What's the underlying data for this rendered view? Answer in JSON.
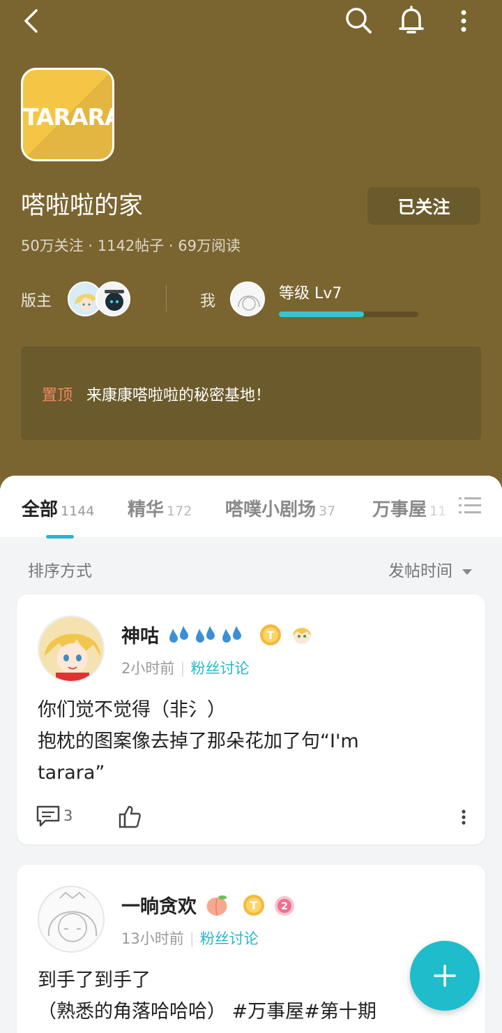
{
  "header": {
    "logo_text": "TARARA",
    "title": "嗒啦啦的家",
    "follow_label": "已关注",
    "stats": "50万关注 · 1142帖子 · 69万阅读",
    "moderator_label": "版主",
    "me_label": "我",
    "level_text": "等级 Lv7",
    "level_progress": 0.61
  },
  "pinned": {
    "tag": "置顶",
    "text": "来康康嗒啦啦的秘密基地！"
  },
  "tabs": [
    {
      "label": "全部",
      "count": "1144"
    },
    {
      "label": "精华",
      "count": "172"
    },
    {
      "label": "嗒噗小剧场",
      "count": "37"
    },
    {
      "label": "万事屋",
      "count": "11"
    }
  ],
  "sort": {
    "label": "排序方式",
    "value": "发帖时间"
  },
  "posts": [
    {
      "author": "神咕",
      "time": "2小时前",
      "category": "粉丝讨论",
      "lines": [
        "你们觉不觉得（非氵）",
        "抱枕的图案像去掉了那朵花加了句“I'm",
        "tarara”"
      ],
      "comments": "3"
    },
    {
      "author": "一晌贪欢",
      "time": "13小时前",
      "category": "粉丝讨论",
      "lines": [
        "到手了到手了",
        "（熟悉的角落哈哈哈） #万事屋#第十期"
      ]
    }
  ],
  "colors": {
    "header_bg": "#7a6530",
    "accent": "#26b6c9",
    "fab": "#1fbccb",
    "pinned_tag": "#f08b5f"
  }
}
